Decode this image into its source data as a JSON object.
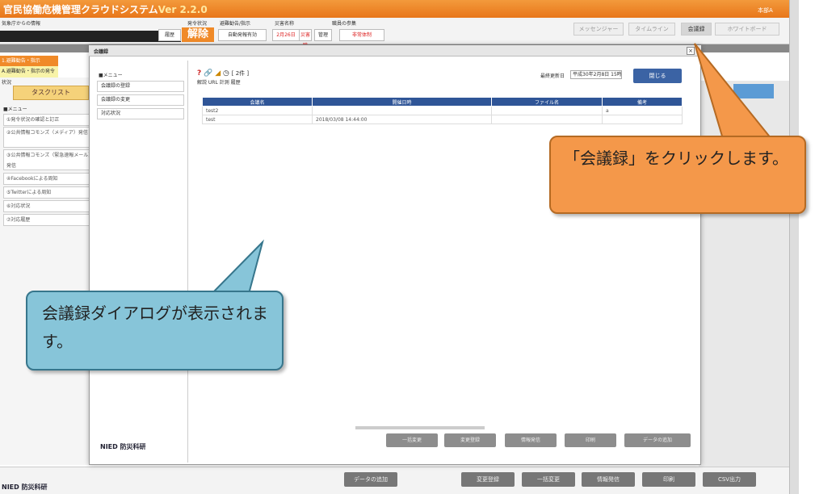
{
  "app": {
    "title": "官民協働危機管理クラウドシステム",
    "version": "Ver 2.2.0",
    "user": "本部A",
    "source_label": "気象庁からの情報"
  },
  "header": {
    "labels": [
      "発令状況",
      "避難勧告/指示",
      "災害名称",
      "職員の参集"
    ],
    "history": "履歴",
    "kaijo": "解除",
    "auto_toggle": "自動発報有効",
    "date": "2月26日",
    "date_suffix": "災害時",
    "manage": "管理",
    "status": "非常体制"
  },
  "topnav": [
    "メッセンジャー",
    "タイムライン",
    "会議録",
    "ホワイトボード"
  ],
  "left": {
    "tab1": "1.避難勧告・指示",
    "tab2": "2.被災状況",
    "yellow": "A.避難勧告・指示の発令状況",
    "task": "タスクリスト",
    "menu_header": "■メニュー",
    "items": [
      "①発令状況の確認と訂正",
      "②公共情報コモンズ（メディア）発信",
      "③公共情報コモンズ（緊急速報メール）発信",
      "④Facebookによる周知",
      "⑤Twitterによる周知",
      "⑥対応状況",
      "⑦対応履歴"
    ],
    "logo": "NIED 防災科研"
  },
  "bg_buttons": [
    "データの追加",
    "変更登録",
    "一括変更",
    "情報発信",
    "印刷",
    "CSV出力"
  ],
  "modal": {
    "title": "会議録",
    "close_x": "×",
    "menu_header": "■メニュー",
    "menu": [
      "会議録の登録",
      "会議録の変更",
      "対応状況"
    ],
    "icons_text": "[ 2件 ]",
    "subicons": "解説 URL 計測 履歴",
    "last_updated_label": "最終更新日",
    "last_updated_value": "平成30年2月8日 15時40分",
    "close_button": "閉じる",
    "columns": [
      "会議名",
      "開催日時",
      "ファイル名",
      "備考"
    ],
    "rows": [
      [
        "test2",
        "",
        "",
        "a"
      ],
      [
        "test",
        "2018/03/08 14:44:00",
        "",
        ""
      ]
    ],
    "bottom_buttons": [
      "一括変更",
      "変更登録",
      "情報発信",
      "印刷",
      "データの追加"
    ],
    "logo": "NIED 防災科研"
  },
  "callouts": {
    "orange": "「会議録」をクリックします。",
    "blue": "会議録ダイアログが表示されます。"
  },
  "colors": {
    "orange": "#f08a28",
    "navy": "#2f5597",
    "callout_orange": "#f4984a",
    "callout_blue": "#87c5d9"
  }
}
